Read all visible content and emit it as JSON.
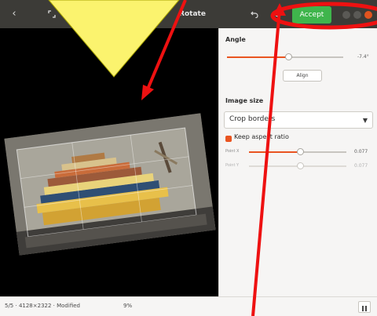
{
  "header": {
    "title": "Rotate",
    "accept_label": "Accept",
    "back_icon": "chevron-left-icon",
    "fullscreen_icon": "expand-icon",
    "undo_icon": "undo-icon",
    "redo_icon": "redo-icon"
  },
  "sidebar": {
    "angle": {
      "title": "Angle",
      "value_text": "-7.4°",
      "align_label": "Align"
    },
    "image_size": {
      "title": "Image size",
      "crop_option": "Crop borders",
      "keep_aspect_label": "Keep aspect ratio",
      "point_x_label": "Point X",
      "point_x_value": "0.077",
      "point_y_label": "Point Y",
      "point_y_value": "0.077"
    }
  },
  "status": {
    "info": "5/5 · 4128×2322 · Modified",
    "zoom": "9%"
  },
  "colors": {
    "accent": "#e95420",
    "accept": "#3fb54c",
    "annotation_red": "#ee1111",
    "annotation_yellow": "#fbf36e"
  }
}
